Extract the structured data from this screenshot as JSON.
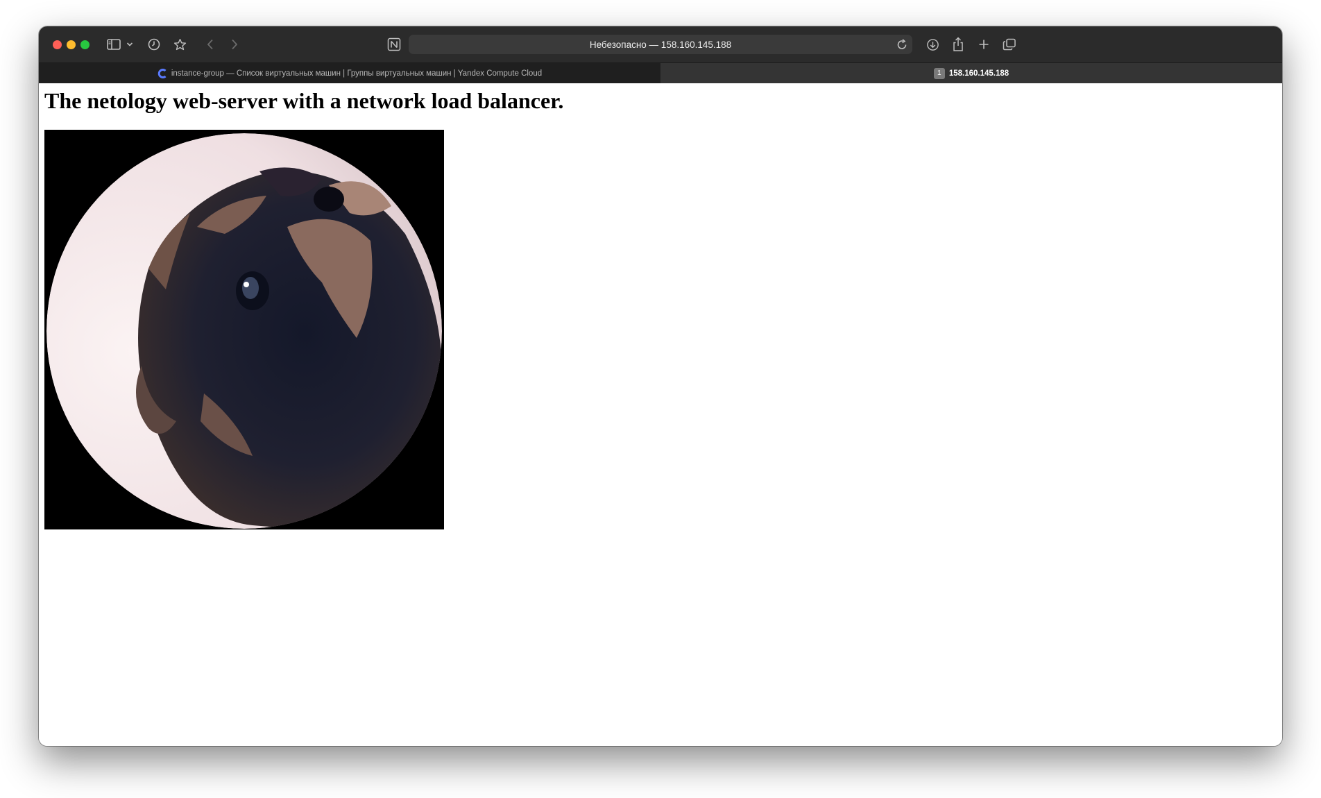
{
  "browser": {
    "address": "Небезопасно — 158.160.145.188",
    "tabs": [
      {
        "title": "instance-group — Список виртуальных машин | Группы виртуальных машин | Yandex Compute Cloud",
        "active": false
      },
      {
        "badge": "1",
        "title": "158.160.145.188",
        "active": true
      }
    ]
  },
  "page": {
    "heading": "The netology web-server with a network load balancer."
  },
  "icons": {
    "sidebar": "sidebar-icon",
    "history": "clock-icon",
    "bookmark": "star-icon",
    "back": "chevron-left-icon",
    "forward": "chevron-right-icon",
    "notion": "notion-icon",
    "reload": "reload-icon",
    "download": "download-icon",
    "share": "share-icon",
    "new_tab": "plus-icon",
    "tabs_overview": "tabs-icon",
    "favicon": "yandex-cloud-icon"
  },
  "colors": {
    "toolbar": "#2b2b2b",
    "address_bar": "#3a3a3a",
    "close": "#fe5f57",
    "minimize": "#febc2e",
    "maximize": "#28c840",
    "favicon": "#5a7bff"
  }
}
